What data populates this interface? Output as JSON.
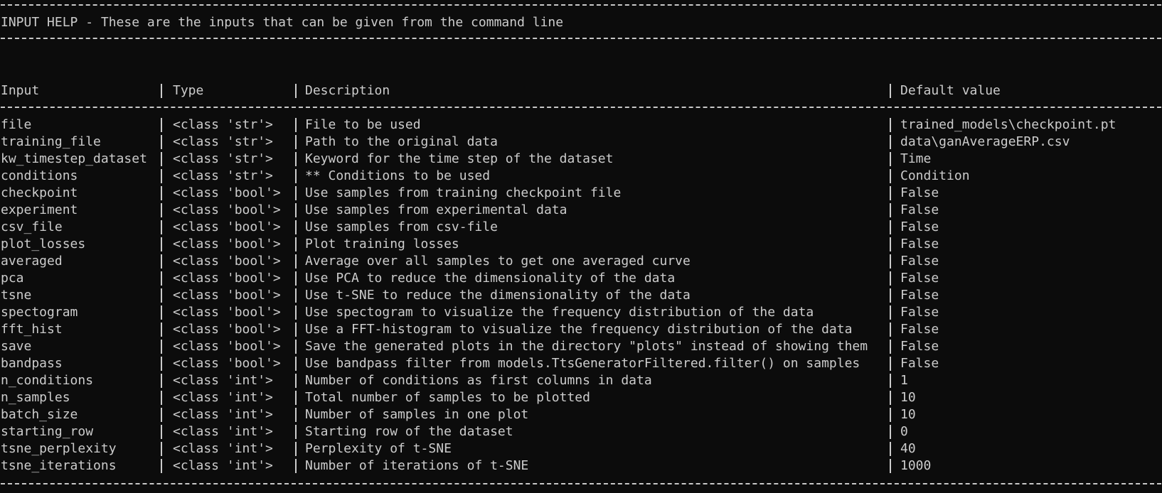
{
  "help_title": "INPUT HELP - These are the inputs that can be given from the command line",
  "headers": {
    "input": "Input",
    "type": "Type",
    "description": "Description",
    "default": "Default value"
  },
  "rows": [
    {
      "input": "file",
      "type": "<class 'str'>",
      "description": "File to be used",
      "default": "trained_models\\checkpoint.pt"
    },
    {
      "input": "training_file",
      "type": "<class 'str'>",
      "description": "Path to the original data",
      "default": "data\\ganAverageERP.csv"
    },
    {
      "input": "kw_timestep_dataset",
      "type": "<class 'str'>",
      "description": "Keyword for the time step of the dataset",
      "default": "Time"
    },
    {
      "input": "conditions",
      "type": "<class 'str'>",
      "description": "** Conditions to be used",
      "default": "Condition"
    },
    {
      "input": "checkpoint",
      "type": "<class 'bool'>",
      "description": "Use samples from training checkpoint file",
      "default": "False"
    },
    {
      "input": "experiment",
      "type": "<class 'bool'>",
      "description": "Use samples from experimental data",
      "default": "False"
    },
    {
      "input": "csv_file",
      "type": "<class 'bool'>",
      "description": "Use samples from csv-file",
      "default": "False"
    },
    {
      "input": "plot_losses",
      "type": "<class 'bool'>",
      "description": "Plot training losses",
      "default": "False"
    },
    {
      "input": "averaged",
      "type": "<class 'bool'>",
      "description": "Average over all samples to get one averaged curve",
      "default": "False"
    },
    {
      "input": "pca",
      "type": "<class 'bool'>",
      "description": "Use PCA to reduce the dimensionality of the data",
      "default": "False"
    },
    {
      "input": "tsne",
      "type": "<class 'bool'>",
      "description": "Use t-SNE to reduce the dimensionality of the data",
      "default": "False"
    },
    {
      "input": "spectogram",
      "type": "<class 'bool'>",
      "description": "Use spectogram to visualize the frequency distribution of the data",
      "default": "False"
    },
    {
      "input": "fft_hist",
      "type": "<class 'bool'>",
      "description": "Use a FFT-histogram to visualize the frequency distribution of the data",
      "default": "False"
    },
    {
      "input": "save",
      "type": "<class 'bool'>",
      "description": "Save the generated plots in the directory \"plots\" instead of showing them",
      "default": "False"
    },
    {
      "input": "bandpass",
      "type": "<class 'bool'>",
      "description": "Use bandpass filter from models.TtsGeneratorFiltered.filter() on samples",
      "default": "False"
    },
    {
      "input": "n_conditions",
      "type": "<class 'int'>",
      "description": "Number of conditions as first columns in data",
      "default": "1"
    },
    {
      "input": "n_samples",
      "type": "<class 'int'>",
      "description": "Total number of samples to be plotted",
      "default": "10"
    },
    {
      "input": "batch_size",
      "type": "<class 'int'>",
      "description": "Number of samples in one plot",
      "default": "10"
    },
    {
      "input": "starting_row",
      "type": "<class 'int'>",
      "description": "Starting row of the dataset",
      "default": "0"
    },
    {
      "input": "tsne_perplexity",
      "type": "<class 'int'>",
      "description": "Perplexity of t-SNE",
      "default": "40"
    },
    {
      "input": "tsne_iterations",
      "type": "<class 'int'>",
      "description": "Number of iterations of t-SNE",
      "default": "1000"
    }
  ]
}
